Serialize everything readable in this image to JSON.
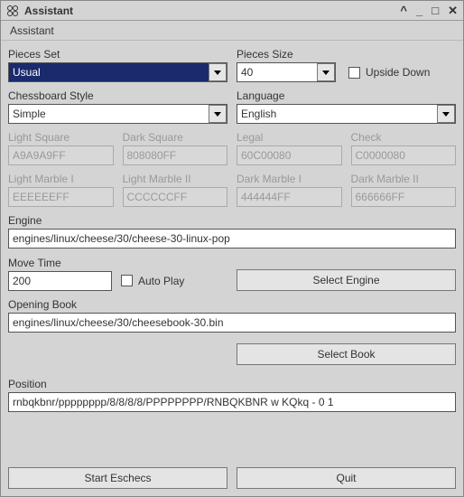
{
  "titlebar": {
    "title": "Assistant"
  },
  "menubar": {
    "item1": "Assistant"
  },
  "labels": {
    "piecesSet": "Pieces Set",
    "piecesSize": "Pieces Size",
    "upsideDown": "Upside Down",
    "chessboardStyle": "Chessboard Style",
    "language": "Language",
    "lightSquare": "Light Square",
    "darkSquare": "Dark Square",
    "legal": "Legal",
    "check": "Check",
    "lightMarble1": "Light Marble I",
    "lightMarble2": "Light Marble II",
    "darkMarble1": "Dark Marble I",
    "darkMarble2": "Dark Marble II",
    "engine": "Engine",
    "moveTime": "Move Time",
    "autoPlay": "Auto Play",
    "openingBook": "Opening Book",
    "position": "Position"
  },
  "values": {
    "piecesSet": "Usual",
    "piecesSize": "40",
    "chessboardStyle": "Simple",
    "language": "English",
    "lightSquare": "A9A9A9FF",
    "darkSquare": "808080FF",
    "legal": "60C00080",
    "check": "C0000080",
    "lightMarble1": "EEEEEEFF",
    "lightMarble2": "CCCCCCFF",
    "darkMarble1": "444444FF",
    "darkMarble2": "666666FF",
    "engine": "engines/linux/cheese/30/cheese-30-linux-pop",
    "moveTime": "200",
    "openingBook": "engines/linux/cheese/30/cheesebook-30.bin",
    "position": "rnbqkbnr/pppppppp/8/8/8/8/PPPPPPPP/RNBQKBNR w KQkq - 0 1"
  },
  "buttons": {
    "selectEngine": "Select Engine",
    "selectBook": "Select Book",
    "startEschecs": "Start Eschecs",
    "quit": "Quit"
  }
}
